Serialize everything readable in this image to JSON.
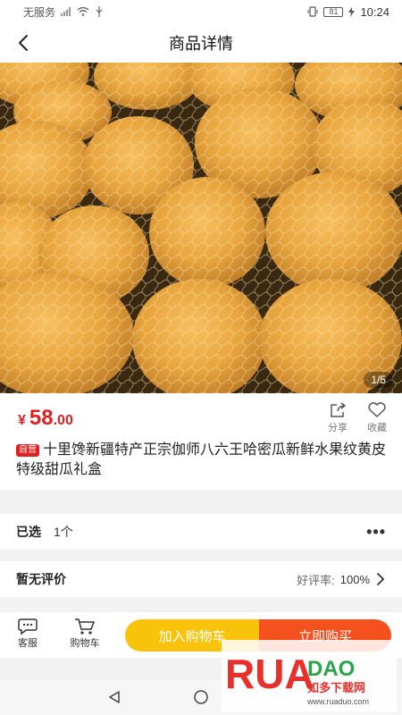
{
  "status_bar": {
    "carrier": "无服务",
    "battery": "81",
    "time": "10:24"
  },
  "nav": {
    "title": "商品详情"
  },
  "gallery": {
    "page_indicator": "1/5"
  },
  "product": {
    "price_currency": "¥",
    "price_integer": "58",
    "price_decimal": ".00",
    "badge": "自营",
    "title": "十里馋新疆特产正宗伽师八六王哈密瓜新鲜水果纹黄皮特级甜瓜礼盒",
    "share_label": "分享",
    "favorite_label": "收藏"
  },
  "selection": {
    "label": "已选",
    "value": "1个",
    "more": "•••"
  },
  "reviews": {
    "label": "暂无评价",
    "rate_label": "好评率:",
    "rate_value": "100%"
  },
  "bottom_bar": {
    "service_label": "客服",
    "cart_label": "购物车",
    "add_to_cart": "加入购物车",
    "buy_now": "立即购买"
  },
  "watermark": {
    "brand": "RUANDAO",
    "cn_text": "如多下载网",
    "url": "www.ruaduo.com"
  },
  "colors": {
    "price_red": "#e02020",
    "add_cart_yellow": "#f9c20b",
    "buy_orange": "#f4511e"
  }
}
